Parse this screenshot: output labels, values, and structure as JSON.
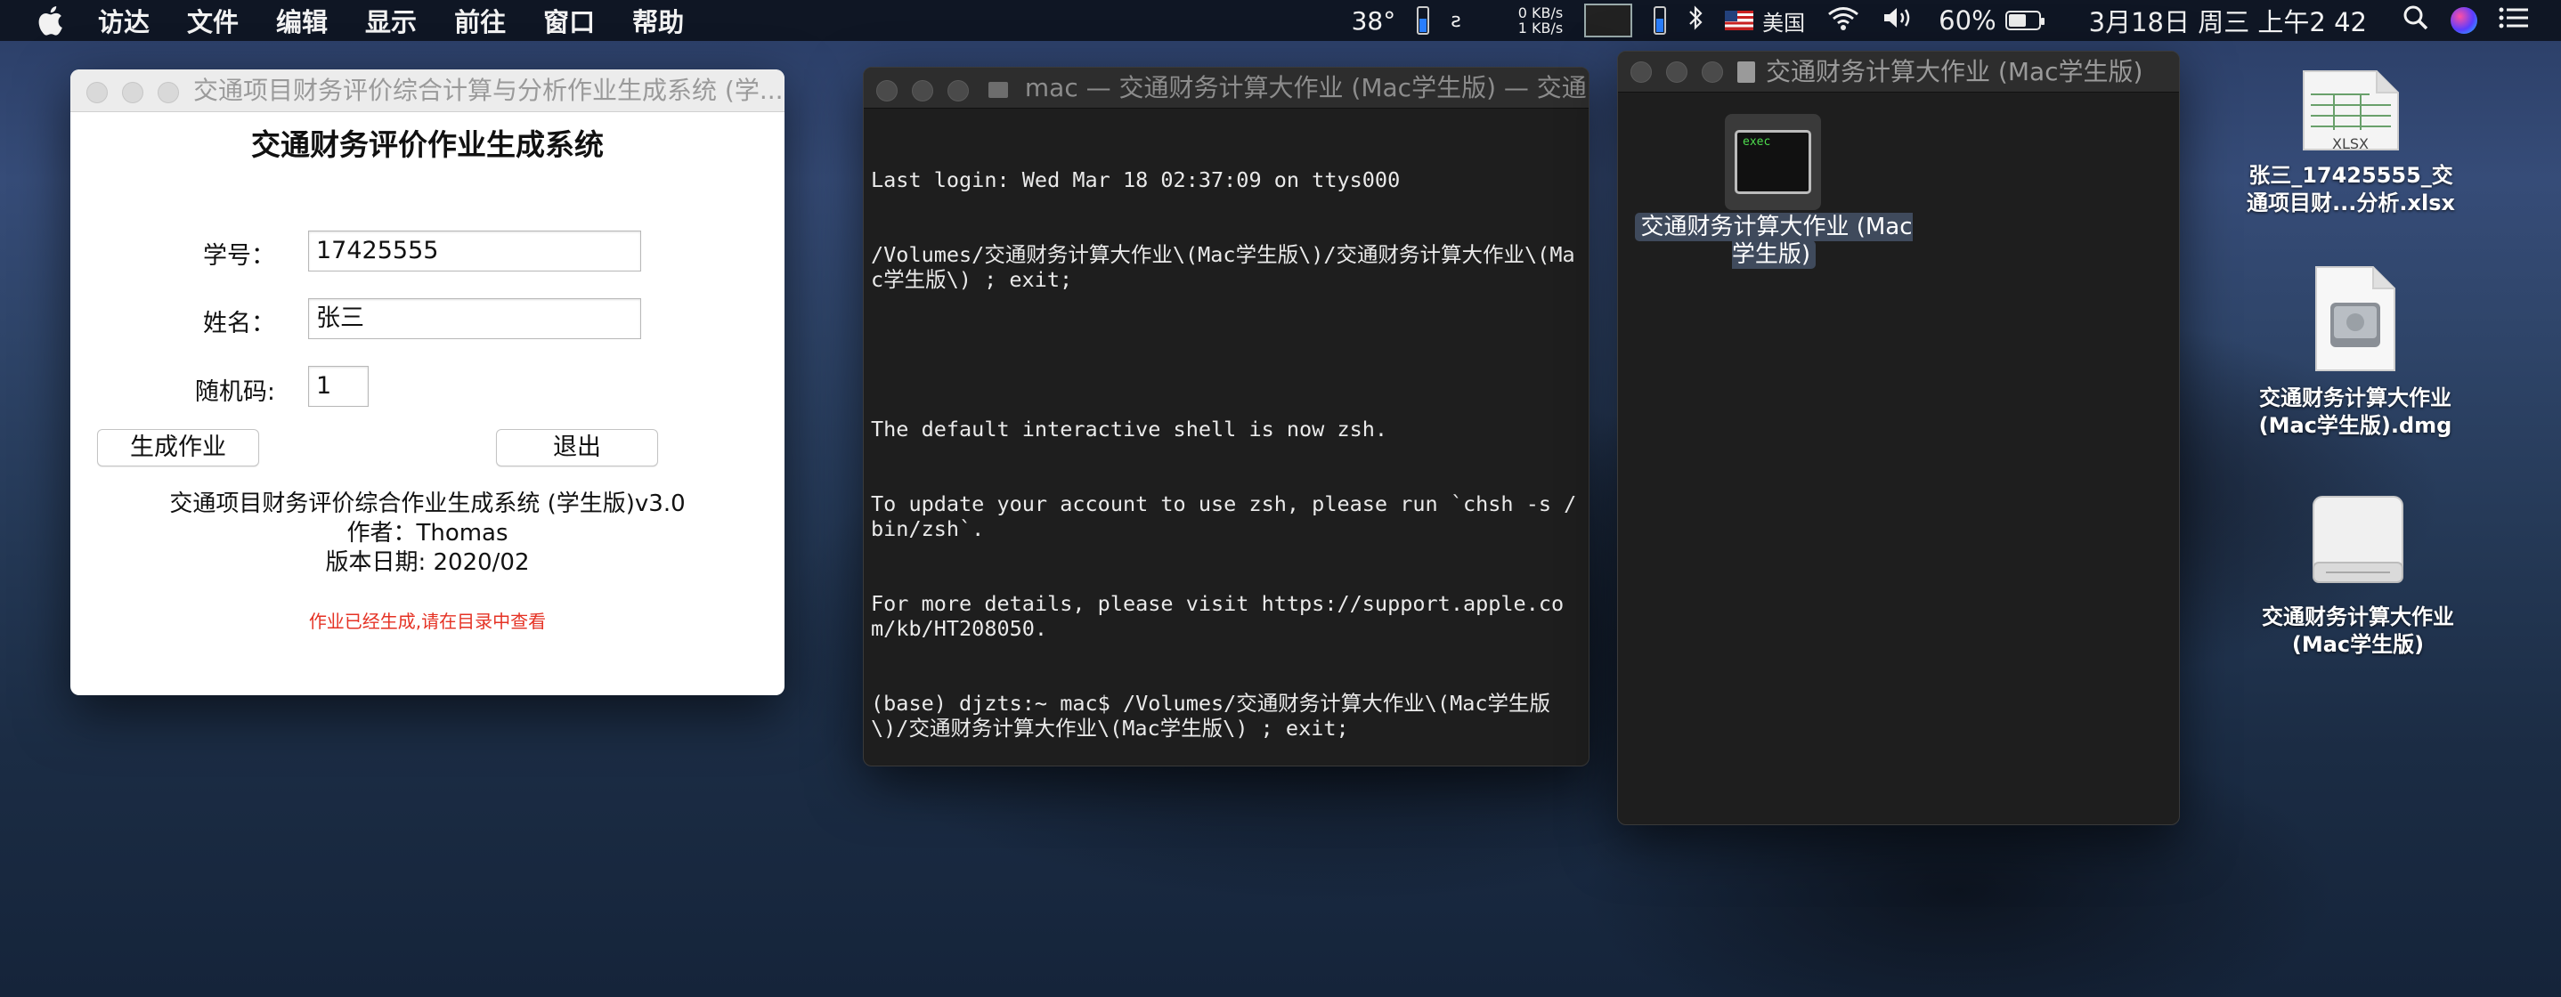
{
  "menubar": {
    "items": [
      "访达",
      "文件",
      "编辑",
      "显示",
      "前往",
      "窗口",
      "帮助"
    ],
    "temp": "38°",
    "net_up": "0 KB/s",
    "net_down": "1 KB/s",
    "input_source": "美国",
    "battery_percent": "60%",
    "datetime": "3月18日 周三 上午2 42"
  },
  "app_window": {
    "title": "交通项目财务评价综合计算与分析作业生成系统 (学...",
    "heading": "交通财务评价作业生成系统",
    "student_id_label": "学号：",
    "student_id_value": "17425555",
    "name_label": "姓名：",
    "name_value": "张三",
    "random_label": "随机码:",
    "random_value": "1",
    "generate_button": "生成作业",
    "exit_button": "退出",
    "info_line1": "交通项目财务评价综合作业生成系统 (学生版)v3.0",
    "info_line2": "作者：Thomas",
    "info_line3": "版本日期: 2020/02",
    "status_message": "作业已经生成,请在目录中查看"
  },
  "terminal_window": {
    "title": "mac — 交通财务计算大作业 (Mac学生版) — 交通...",
    "lines": [
      "Last login: Wed Mar 18 02:37:09 on ttys000",
      "/Volumes/交通财务计算大作业\\(Mac学生版\\)/交通财务计算大作业\\(Mac学生版\\) ; exit;",
      "",
      "The default interactive shell is now zsh.",
      "To update your account to use zsh, please run `chsh -s /bin/zsh`.",
      "For more details, please visit https://support.apple.com/kb/HT208050.",
      "(base) djzts:~ mac$ /Volumes/交通财务计算大作业\\(Mac学生版\\)/交通财务计算大作业\\(Mac学生版\\) ; exit;"
    ]
  },
  "finder_window": {
    "title": "交通财务计算大作业 (Mac学生版)",
    "item_label": "交通财务计算大作业 (Mac学生版)",
    "item_icon_text": "exec"
  },
  "desktop": {
    "xlsx_label": "张三_17425555_交通项目财...分析.xlsx",
    "xlsx_icon_text": "XLSX",
    "dmg_label": "交通财务计算大作业(Mac学生版).dmg",
    "volume_label": "交通财务计算大作业(Mac学生版)"
  }
}
